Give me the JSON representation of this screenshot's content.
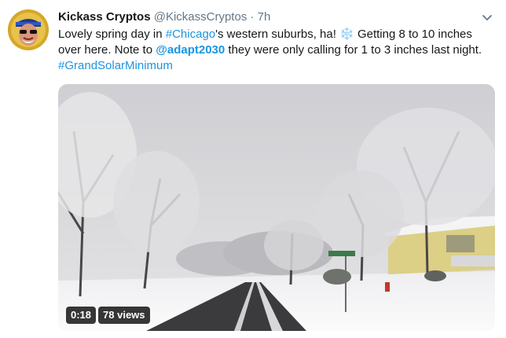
{
  "tweet": {
    "display_name": "Kickass Cryptos",
    "handle": "@KickassCryptos",
    "separator": "·",
    "time": "7h",
    "text": {
      "part1": "Lovely spring day in ",
      "hashtag1": "#Chicago",
      "part2": "'s western suburbs, ha! ",
      "emoji": "❄️",
      "part3": " Getting 8 to 10 inches over here. Note to ",
      "mention": "@adapt2030",
      "part4": " they were only calling for 1 to 3 inches last night. ",
      "hashtag2": "#GrandSolarMinimum"
    },
    "video": {
      "duration": "0:18",
      "views": "78 views"
    }
  },
  "colors": {
    "link": "#1b95e0",
    "name": "#14171a",
    "meta": "#657786"
  },
  "icons": {
    "caret": "chevron-down-icon",
    "avatar": "avatar"
  }
}
